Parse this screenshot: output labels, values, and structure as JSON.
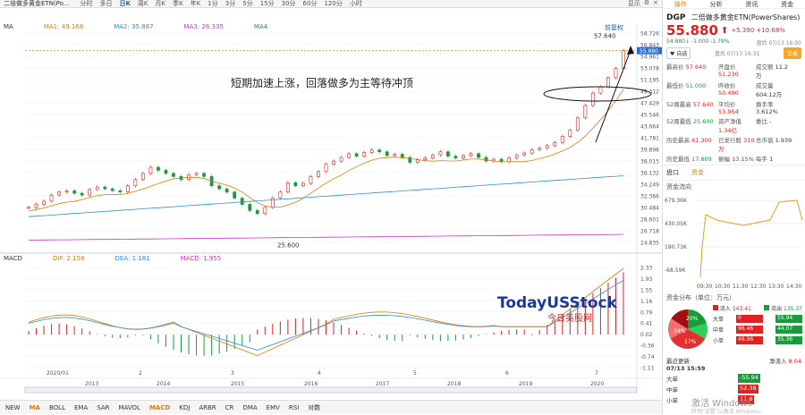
{
  "window": {
    "title": "二倍做多黄金ETN(Po...",
    "tabs": [
      "分时",
      "多日",
      "日K",
      "周K",
      "月K",
      "季K",
      "年K",
      "1分",
      "3分",
      "5分",
      "15分",
      "30分",
      "60分",
      "120分",
      "小时"
    ],
    "active_tab": "日K",
    "right_controls": [
      "显示",
      "⚙",
      "×"
    ]
  },
  "chart_toolbar": {
    "label": "前复权",
    "icons": [
      "undo",
      "redo",
      "search",
      "zoom-in",
      "camera",
      "settings"
    ]
  },
  "ma_legend": [
    {
      "name": "MA",
      "label": "MA",
      "color": "#333333"
    },
    {
      "name": "MA1",
      "label": "MA1: 49.168",
      "color": "#e07b00"
    },
    {
      "name": "MA2",
      "label": "MA2: 35.887",
      "color": "#2a8de0"
    },
    {
      "name": "MA3",
      "label": "MA3: 26.335",
      "color": "#cc33cc"
    },
    {
      "name": "MA4",
      "label": "MA4",
      "color": "#1a9a3a"
    }
  ],
  "macd_legend": [
    {
      "name": "MACD",
      "label": "MACD",
      "color": "#333333"
    },
    {
      "name": "DIF",
      "label": "DIF: 2.158",
      "color": "#e07b00"
    },
    {
      "name": "DEA",
      "label": "DEA: 1.181",
      "color": "#2a8de0"
    },
    {
      "name": "MACDV",
      "label": "MACD: 1.955",
      "color": "#cc33cc"
    }
  ],
  "price_axis": [
    "58.726",
    "56.843",
    "54.961",
    "53.078",
    "51.195",
    "49.312",
    "47.429",
    "45.546",
    "43.664",
    "41.781",
    "39.898",
    "38.015",
    "36.132",
    "34.249",
    "32.366",
    "30.484",
    "28.601",
    "26.718",
    "24.835"
  ],
  "macd_axis": [
    "2.33",
    "1.93",
    "1.55",
    "1.16",
    "0.79",
    "0.41",
    "0.02",
    "-0.36",
    "-0.74",
    "-1.11"
  ],
  "current_price_tag": "55.880",
  "annotations": {
    "high": "57.640",
    "low": "25.600",
    "comment": "短期加速上涨，回落做多为主等待冲顶",
    "watermark_main": "TodayUSStock",
    "watermark_sub": "今日美股网"
  },
  "time_axis_top": [
    "2020/01",
    "2",
    "3",
    "4",
    "5",
    "6",
    "7"
  ],
  "time_axis_bottom": [
    "2013",
    "2014",
    "2015",
    "2016",
    "2017",
    "2018",
    "2019",
    "2020"
  ],
  "indicators": [
    "NEW",
    "MA",
    "BOLL",
    "EMA",
    "SAR",
    "MAVOL",
    "MACD",
    "KDJ",
    "ARBR",
    "CR",
    "DMA",
    "EMV",
    "RSI",
    "对数"
  ],
  "active_indicators": [
    "MA",
    "MACD"
  ],
  "right_panel": {
    "tabs": [
      "操作",
      "分析",
      "资讯",
      "资金"
    ],
    "active_tab": "操作",
    "code": "DGP",
    "name": "二倍做多黄金ETN(PowerShares)",
    "price": "55.880",
    "arrow": "⬆",
    "change": "+5.390 +10.68%",
    "time": "盘后 07/13 16:00",
    "after_hours": "54.880↓ -1.000 -1.79%",
    "after_time": "盘后 07/13 16:31",
    "btn_watch": "自选",
    "btn_trade": "交易",
    "stats": [
      {
        "k": "最高价",
        "v": "57.640",
        "k2": "开盘价",
        "v2": "51.230",
        "k3": "成交额",
        "v3": "11.2万"
      },
      {
        "k": "最低价",
        "v": "51.000",
        "k2": "昨收价",
        "v2": "50.490",
        "k3": "成交量",
        "v3": "604.12万"
      },
      {
        "k": "52周最高",
        "v": "57.640",
        "k2": "平均价",
        "v2": "53.954",
        "k3": "换手率",
        "v3": "3.612%"
      },
      {
        "k": "52周最低",
        "v": "25.600",
        "k2": "资产净值",
        "v2": "1.34亿",
        "k3": "委比",
        "v3": "-"
      },
      {
        "k": "历史最高",
        "v": "61.300",
        "k2": "已发行股",
        "v2": "310万",
        "k3": "总市值",
        "v3": "1.939"
      },
      {
        "k": "历史最低",
        "v": "17.809",
        "k2": "振幅",
        "v2": "13.15%",
        "k3": "每手",
        "v3": "1"
      }
    ],
    "subtabs": [
      "盘口",
      "资金"
    ],
    "active_subtab": "资金",
    "flow_title": "资金流向",
    "flow_axis": [
      "679.36K",
      "430.05K",
      "180.73K",
      "-68.59K"
    ],
    "flow_times": [
      "09:30",
      "10:30",
      "11:30",
      "12:30",
      "13:30",
      "14:30",
      "16"
    ],
    "dist_title": "资金分布（单位：万元）",
    "inflow_label": "流入",
    "inflow_total": "143.41",
    "outflow_label": "流出",
    "outflow_total": "135.37",
    "pie_labels": [
      "20%",
      "34%",
      "17%"
    ],
    "dist_rows": [
      {
        "name": "大单",
        "in": "0",
        "out": "55.94"
      },
      {
        "name": "中单",
        "in": "96.46",
        "out": "44.07"
      },
      {
        "name": "小单",
        "in": "46.96",
        "out": "35.36"
      }
    ],
    "net_title": "净流入",
    "net_total": "8.04",
    "update_label": "最近更新:",
    "update_time": "07/13 15:59",
    "net_rows": [
      {
        "name": "大单",
        "val": "-55.94"
      },
      {
        "name": "中单",
        "val": "52.38"
      },
      {
        "name": "小单",
        "val": "11.6"
      }
    ],
    "activate": "激活 Windows",
    "activate_sub": "转到\"设置\"以激活 Windows。"
  }
}
